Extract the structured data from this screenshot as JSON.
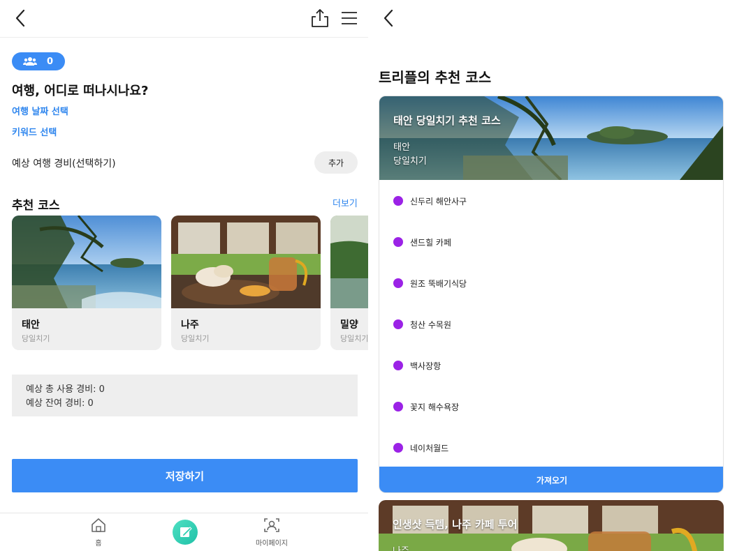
{
  "left": {
    "people_count": "0",
    "question": "여행, 어디로 떠나시나요?",
    "date_select": "여행 날짜 선택",
    "keyword_select": "키워드 선택",
    "budget_label": "예상 여행 경비(선택하기)",
    "add_button": "추가",
    "recommend_title": "추천 코스",
    "more_link": "더보기",
    "courses": [
      {
        "name": "태안",
        "type": "당일치기"
      },
      {
        "name": "나주",
        "type": "당일치기"
      },
      {
        "name": "밀양",
        "type": "당일치기"
      }
    ],
    "summary": {
      "total": "예상 총 사용 경비: 0",
      "remaining": "예상 잔여 경비: 0"
    },
    "save_button": "저장하기",
    "nav": {
      "home": "홈",
      "mypage": "마이페이지"
    }
  },
  "right": {
    "title": "트리플의 추천 코스",
    "card1": {
      "title": "태안 당일치기 추천 코스",
      "location": "태안",
      "type": "당일치기",
      "stops": [
        "신두리 해안사구",
        "샌드힐 카페",
        "원조 뚝배기식당",
        "청산 수목원",
        "백사장항",
        "꽃지 해수욕장",
        "네이처월드"
      ],
      "import_button": "가져오기"
    },
    "card2": {
      "title": "인생샷 득템, 나주 카페 투어",
      "location": "나주"
    }
  },
  "colors": {
    "primary": "#3b8cf5",
    "link": "#2f86ee",
    "stop_dot": "#9b22e6",
    "fab": "#2ccfb3"
  },
  "icons": [
    "back-icon",
    "share-icon",
    "menu-icon",
    "people-icon",
    "home-icon",
    "edit-icon",
    "mypage-icon"
  ]
}
